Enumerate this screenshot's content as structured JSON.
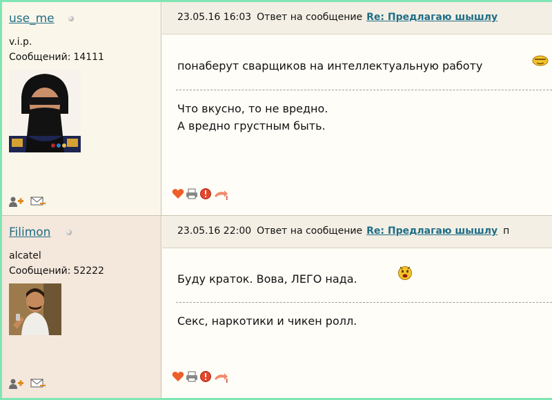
{
  "posts": [
    {
      "username": "use_me",
      "rank": "v.i.p.",
      "count_label": "Сообщений:",
      "count": "14111",
      "date": "23.05.16 16:03",
      "reply_label": "Ответ на сообщение",
      "topic": "Re: Предлагаю шышлу",
      "quote": "понаберут сварщиков на интеллектуальную работу",
      "body": [
        "Что вкусно, то не вредно.",
        "А вредно грустным быть."
      ]
    },
    {
      "username": "Filimon",
      "rank": "alcatel",
      "count_label": "Сообщений:",
      "count": "52222",
      "date": "23.05.16 22:00",
      "reply_label": "Ответ на сообщение",
      "topic": "Re: Предлагаю шышлу",
      "more": "п",
      "quote": "Буду краток. Вова, ЛЕГО нада.",
      "body": [
        "Секс, наркотики и чикен ролл."
      ]
    }
  ],
  "colors": {
    "link": "#1f6d86",
    "frame": "#7fe6b3",
    "heart": "#ef5f2a"
  }
}
